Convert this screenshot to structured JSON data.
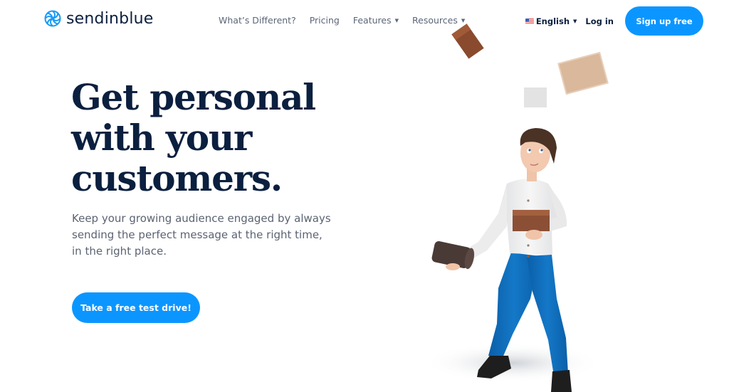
{
  "brand": {
    "name": "sendinblue",
    "logo_icon": "sendinblue-swirl-logo",
    "accent_color": "#0b96ff",
    "text_color": "#0b1f3f"
  },
  "nav": {
    "links": [
      {
        "label": "What’s Different?",
        "has_dropdown": false
      },
      {
        "label": "Pricing",
        "has_dropdown": false
      },
      {
        "label": "Features",
        "has_dropdown": true
      },
      {
        "label": "Resources",
        "has_dropdown": true
      }
    ],
    "language": {
      "label": "English",
      "flag_icon": "us-flag-icon",
      "has_dropdown": true
    },
    "login_label": "Log in",
    "signup_label": "Sign up free"
  },
  "hero": {
    "title_lines": [
      "Get personal",
      "with your",
      "customers."
    ],
    "subtitle_lines": [
      "Keep your growing audience engaged by always",
      "sending the perfect message at the right time,",
      "in the right place."
    ],
    "cta_label": "Take a free test drive!"
  },
  "illustration": {
    "description": "3D man juggling wooden blocks",
    "shirt_color": "#f1f1f1",
    "pants_color": "#0f6fbd",
    "block_colors": [
      "#8a4a2e",
      "#d9b89c",
      "#e6e6e6",
      "#8b4f35",
      "#4a3a36"
    ]
  }
}
